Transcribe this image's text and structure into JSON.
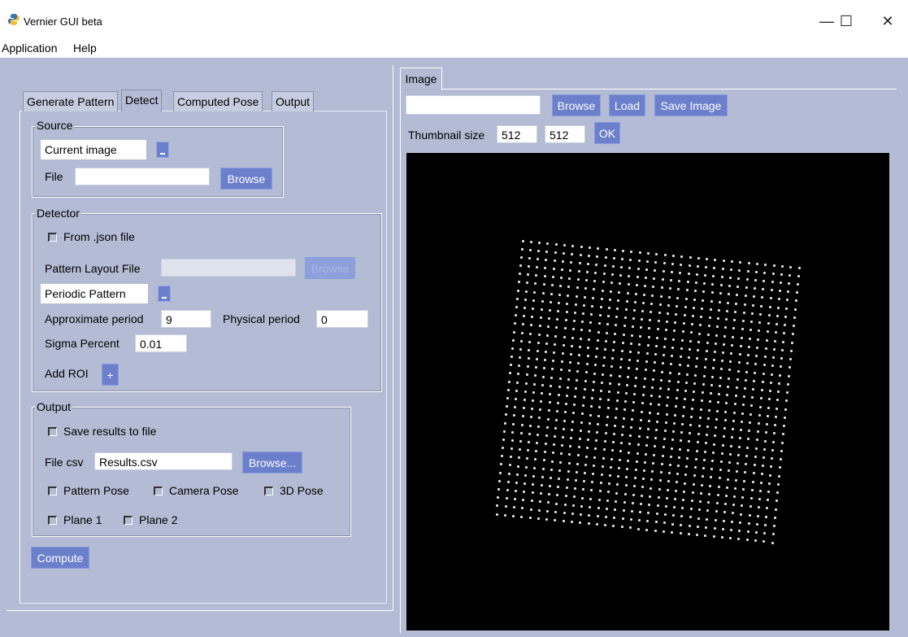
{
  "window": {
    "title": "Vernier GUI beta",
    "minimize": "—",
    "maximize": "☐",
    "close": "✕"
  },
  "menu": [
    "Application",
    "Help"
  ],
  "left_tabs": [
    "Generate Pattern",
    "Detect",
    "Computed Pose",
    "Output"
  ],
  "source": {
    "group": "Source",
    "dropdown_value": "Current image",
    "file_label": "File",
    "file_value": "",
    "browse": "Browse"
  },
  "detector": {
    "group": "Detector",
    "from_json": "From .json file",
    "layout_label": "Pattern Layout File",
    "layout_value": "",
    "layout_browse": "Browse",
    "pattern_type": "Periodic Pattern",
    "approx_label": "Approximate period",
    "approx_value": "9",
    "physical_label": "Physical period",
    "physical_value": "0",
    "sigma_label": "Sigma Percent",
    "sigma_value": "0.01",
    "roi_label": "Add ROI",
    "roi_button": "+"
  },
  "output": {
    "group": "Output",
    "save_results": "Save results to file",
    "csv_label": "File csv",
    "csv_value": "Results.csv",
    "csv_browse": "Browse...",
    "pattern_pose": "Pattern Pose",
    "camera_pose": "Camera Pose",
    "pose_3d": "3D Pose",
    "plane1": "Plane 1",
    "plane2": "Plane 2"
  },
  "compute": "Compute",
  "image_panel": {
    "tab": "Image",
    "path_value": "",
    "browse": "Browse",
    "load": "Load",
    "save": "Save Image",
    "thumb_label": "Thumbnail size",
    "thumb_w": "512",
    "thumb_h": "512",
    "ok": "OK"
  },
  "colors": {
    "background": "#b3bcd4",
    "button": "#6b7fcb",
    "canvas": "#000000",
    "dot": "#e0e0e0"
  },
  "canvas_pattern": {
    "rows": 34,
    "cols": 34
  }
}
